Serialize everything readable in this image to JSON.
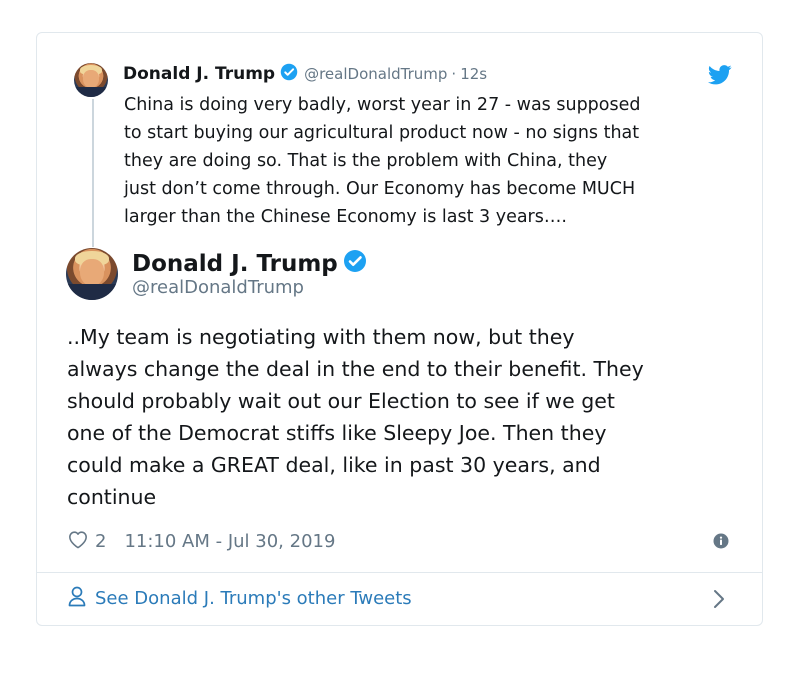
{
  "quoted_tweet": {
    "name": "Donald J. Trump",
    "handle": "@realDonaldTrump",
    "separator": "·",
    "time_ago": "12s",
    "text_lines": [
      "China is doing very badly, worst year in 27 - was supposed",
      "to start buying our agricultural product now - no signs that",
      "they are doing so. That is the problem with China, they",
      "just don’t come through. Our Economy has become MUCH",
      "larger than the Chinese Economy is last 3 years…."
    ]
  },
  "main_tweet": {
    "name": "Donald J. Trump",
    "handle": "@realDonaldTrump",
    "text_lines": [
      "..My team is negotiating with them now, but they",
      "always change the deal in the end to their benefit. They",
      "should probably wait out our Election to see if we get",
      "one of the Democrat stiffs like Sleepy Joe. Then they",
      "could make a GREAT deal, like in past 30 years, and",
      "continue"
    ],
    "like_count": "2",
    "timestamp": "11:10 AM - Jul 30, 2019"
  },
  "footer": {
    "label": "See Donald J. Trump's other Tweets"
  },
  "icons": {
    "verified": "verified-badge-icon",
    "bird": "twitter-bird-icon",
    "heart": "heart-icon",
    "info": "info-icon",
    "user": "user-icon",
    "chevron": "chevron-right-icon"
  },
  "colors": {
    "verified_blue": "#1da1f2",
    "link_blue": "#2b7bb9",
    "muted": "#657786",
    "text": "#14171a",
    "border": "#e1e8ed"
  }
}
